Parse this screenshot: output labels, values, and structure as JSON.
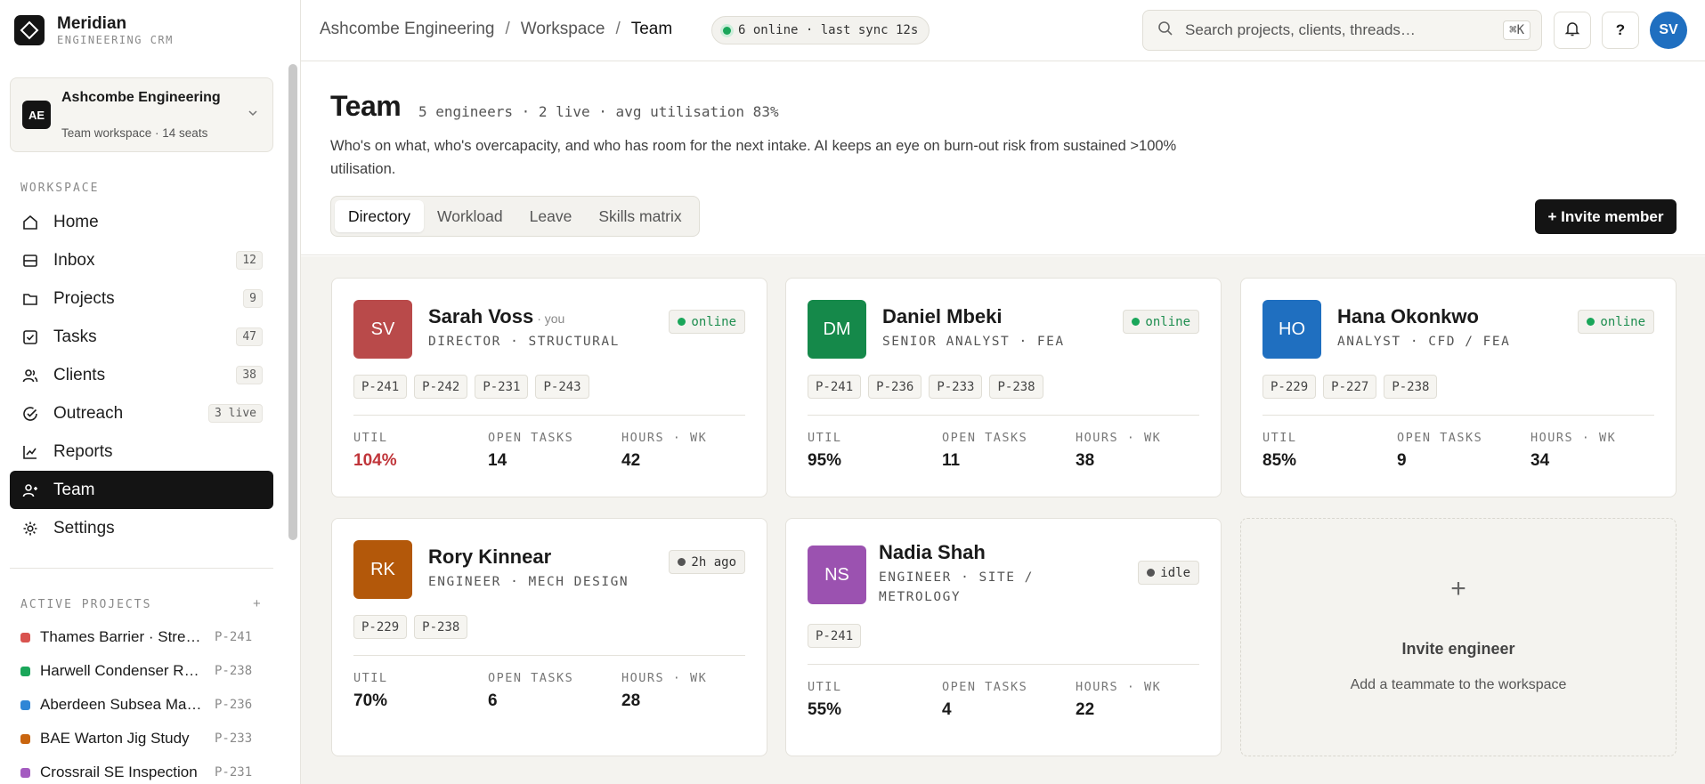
{
  "brand": {
    "name": "Meridian",
    "sub": "ENGINEERING CRM"
  },
  "workspace": {
    "avatar": "AE",
    "name": "Ashcombe Engineering",
    "sub": "Team workspace · 14 seats"
  },
  "sidebar": {
    "section_label": "WORKSPACE",
    "items": [
      {
        "label": "Home",
        "count": ""
      },
      {
        "label": "Inbox",
        "count": "12"
      },
      {
        "label": "Projects",
        "count": "9"
      },
      {
        "label": "Tasks",
        "count": "47"
      },
      {
        "label": "Clients",
        "count": "38"
      },
      {
        "label": "Outreach",
        "count": "3 live"
      },
      {
        "label": "Reports",
        "count": ""
      },
      {
        "label": "Team",
        "count": ""
      },
      {
        "label": "Settings",
        "count": ""
      }
    ],
    "projects_label": "ACTIVE PROJECTS",
    "projects_add": "+",
    "projects": [
      {
        "name": "Thames Barrier · Stress Analysis",
        "id": "P-241",
        "color": "#d9534f"
      },
      {
        "name": "Harwell Condenser Retrofit",
        "id": "P-238",
        "color": "#1aa65a"
      },
      {
        "name": "Aberdeen Subsea Manifold",
        "id": "P-236",
        "color": "#2f86d6"
      },
      {
        "name": "BAE Warton Jig Study",
        "id": "P-233",
        "color": "#c9650f"
      },
      {
        "name": "Crossrail SE Inspection",
        "id": "P-231",
        "color": "#a45bc0"
      }
    ]
  },
  "topbar": {
    "breadcrumb": [
      "Ashcombe Engineering",
      "Workspace",
      "Team"
    ],
    "sync": "6 online · last sync 12s",
    "search_placeholder": "Search projects, clients, threads…",
    "search_kbd": "⌘K",
    "help": "?",
    "user_initials": "SV"
  },
  "page": {
    "title": "Team",
    "stats": "5 engineers · 2 live · avg utilisation 83%",
    "description": "Who's on what, who's overcapacity, and who has room for the next intake. AI keeps an eye on burn-out risk from sustained >100% utilisation.",
    "tabs": [
      "Directory",
      "Workload",
      "Leave",
      "Skills matrix"
    ],
    "invite_button": "+ Invite member"
  },
  "stat_labels": {
    "util": "UTIL",
    "tasks": "OPEN TASKS",
    "hours": "HOURS · WK"
  },
  "members": [
    {
      "initials": "SV",
      "name": "Sarah Voss",
      "you": "· you",
      "role": "DIRECTOR · STRUCTURAL",
      "status": "online",
      "projects": [
        "P-241",
        "P-242",
        "P-231",
        "P-243"
      ],
      "util": "104%",
      "tasks": "14",
      "hours": "42",
      "color": "#b94a4a"
    },
    {
      "initials": "DM",
      "name": "Daniel Mbeki",
      "you": "",
      "role": "SENIOR ANALYST · FEA",
      "status": "online",
      "projects": [
        "P-241",
        "P-236",
        "P-233",
        "P-238"
      ],
      "util": "95%",
      "tasks": "11",
      "hours": "38",
      "color": "#15894a"
    },
    {
      "initials": "HO",
      "name": "Hana Okonkwo",
      "you": "",
      "role": "ANALYST · CFD / FEA",
      "status": "online",
      "projects": [
        "P-229",
        "P-227",
        "P-238"
      ],
      "util": "85%",
      "tasks": "9",
      "hours": "34",
      "color": "#1f6fc0"
    },
    {
      "initials": "RK",
      "name": "Rory Kinnear",
      "you": "",
      "role": "ENGINEER · MECH DESIGN",
      "status": "2h ago",
      "projects": [
        "P-229",
        "P-238"
      ],
      "util": "70%",
      "tasks": "6",
      "hours": "28",
      "color": "#b3580a"
    },
    {
      "initials": "NS",
      "name": "Nadia Shah",
      "you": "",
      "role": "ENGINEER · SITE / METROLOGY",
      "status": "idle",
      "projects": [
        "P-241"
      ],
      "util": "55%",
      "tasks": "4",
      "hours": "22",
      "color": "#9b52b0"
    }
  ],
  "invite_card": {
    "plus": "+",
    "title": "Invite engineer",
    "sub": "Add a teammate to the workspace"
  }
}
